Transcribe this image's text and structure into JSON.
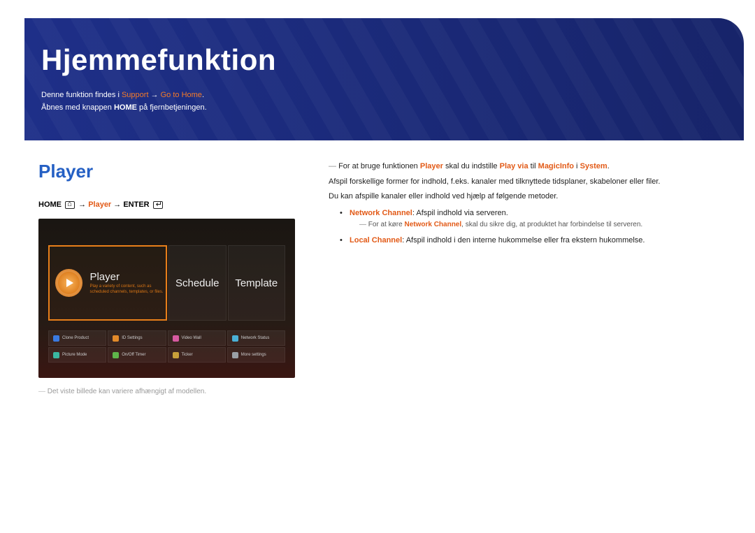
{
  "banner": {
    "title": "Hjemmefunktion",
    "desc_prefix": "Denne funktion findes i ",
    "support": "Support",
    "arrow": " → ",
    "goto_home": "Go to Home",
    "period": ".",
    "open_prefix": "Åbnes med knappen ",
    "home_btn": "HOME",
    "open_suffix": " på fjernbetjeningen."
  },
  "section": {
    "title": "Player",
    "nav_home": "HOME",
    "nav_player": "Player",
    "nav_enter": "ENTER",
    "arrow": " → "
  },
  "screenshot": {
    "card_player": "Player",
    "card_player_sub": "Play a variety of content, such as scheduled channels, templates, or files.",
    "card_schedule": "Schedule",
    "card_template": "Template",
    "items": [
      "Clone Product",
      "ID Settings",
      "Video Wall",
      "Network Status",
      "Picture Mode",
      "On/Off Timer",
      "Ticker",
      "More settings"
    ]
  },
  "disclaimer": "Det viste billede kan variere afhængigt af modellen.",
  "right": {
    "note1_prefix": "For at bruge funktionen ",
    "note1_player": "Player",
    "note1_mid": " skal du indstille ",
    "note1_playvia": "Play via",
    "note1_to": " til ",
    "note1_magic": "MagicInfo",
    "note1_in": " i ",
    "note1_system": "System",
    "period": ".",
    "p1": "Afspil forskellige former for indhold, f.eks. kanaler med tilknyttede tidsplaner, skabeloner eller filer.",
    "p2": "Du kan afspille kanaler eller indhold ved hjælp af følgende metoder.",
    "li1_label": "Network Channel",
    "li1_text": ": Afspil indhold via serveren.",
    "li1_note_prefix": "For at køre ",
    "li1_note_label": "Network Channel",
    "li1_note_suffix": ", skal du sikre dig, at produktet har forbindelse til serveren.",
    "li2_label": "Local Channel",
    "li2_text": ": Afspil indhold i den interne hukommelse eller fra ekstern hukommelse."
  }
}
